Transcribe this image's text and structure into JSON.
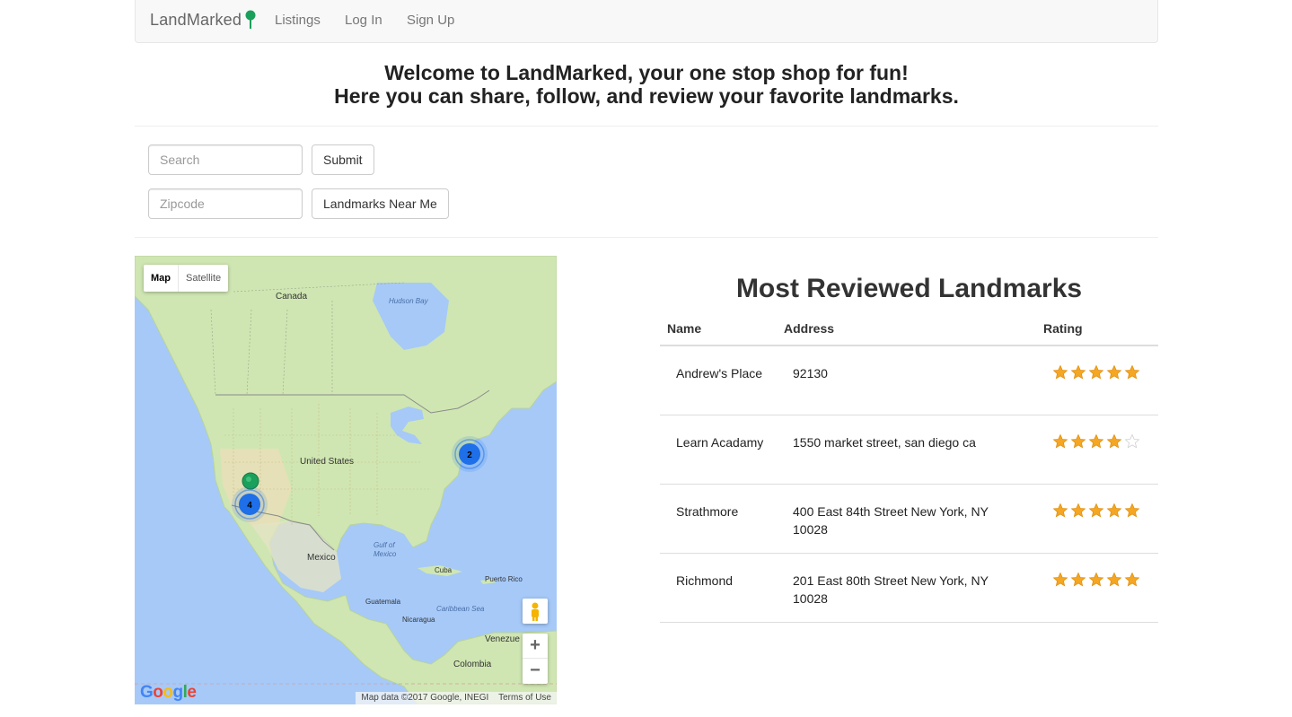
{
  "nav": {
    "brand": "LandMarked",
    "links": [
      "Listings",
      "Log In",
      "Sign Up"
    ]
  },
  "welcome": {
    "line1": "Welcome to LandMarked, your one stop shop for fun!",
    "line2": "Here you can share, follow, and review your favorite landmarks."
  },
  "search": {
    "placeholder": "Search",
    "button": "Submit"
  },
  "zipcode": {
    "placeholder": "Zipcode",
    "button": "Landmarks Near Me"
  },
  "map": {
    "type_map": "Map",
    "type_satellite": "Satellite",
    "labels": {
      "canada": "Canada",
      "hudson": "Hudson Bay",
      "us": "United States",
      "mexico": "Mexico",
      "gulf1": "Gulf of",
      "gulf2": "Mexico",
      "cuba": "Cuba",
      "pr": "Puerto Rico",
      "guat": "Guatemala",
      "nic": "Nicaragua",
      "carib": "Caribbean Sea",
      "ven": "Venezue",
      "col": "Colombia"
    },
    "cluster_west": "4",
    "cluster_east": "2",
    "zoom_in": "+",
    "zoom_out": "−",
    "google": "Google",
    "attribution": "Map data ©2017 Google, INEGI",
    "terms": "Terms of Use"
  },
  "colors": {
    "accent": "#1aa05a",
    "star": "#f5a623",
    "cluster": "#1e6fe8"
  },
  "table": {
    "title": "Most Reviewed Landmarks",
    "headers": {
      "name": "Name",
      "address": "Address",
      "rating": "Rating"
    },
    "rows": [
      {
        "name": "Andrew's Place",
        "address": "92130",
        "rating": 5
      },
      {
        "name": "Learn Acadamy",
        "address": "1550 market street, san diego ca",
        "rating": 4
      },
      {
        "name": "Strathmore",
        "address": "400 East 84th Street New York, NY 10028",
        "rating": 5
      },
      {
        "name": "Richmond",
        "address": "201 East 80th Street New York, NY 10028",
        "rating": 5
      }
    ]
  }
}
